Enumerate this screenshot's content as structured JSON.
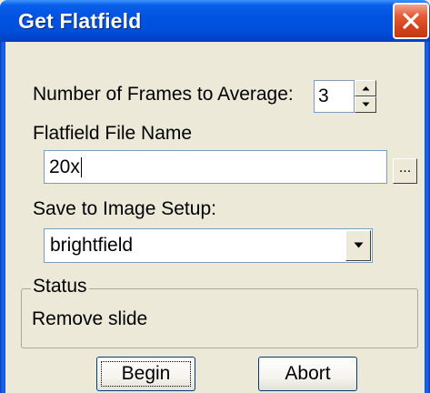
{
  "window": {
    "title": "Get Flatfield"
  },
  "frames": {
    "label": "Number of Frames to Average:",
    "value": "3"
  },
  "flatfield": {
    "label": "Flatfield File Name",
    "value": "20x",
    "browse_label": "..."
  },
  "image_setup": {
    "label": "Save to Image Setup:",
    "selected": "brightfield"
  },
  "status": {
    "group_label": "Status",
    "text": "Remove slide"
  },
  "buttons": {
    "begin": "Begin",
    "abort": "Abort"
  },
  "colors": {
    "titlebar": "#0053e1",
    "close": "#d2431c",
    "dialog_bg": "#ece9d8"
  },
  "icons": {
    "close": "close-icon",
    "spin_up": "spin-up-icon",
    "spin_down": "spin-down-icon",
    "dropdown": "chevron-down-icon"
  }
}
